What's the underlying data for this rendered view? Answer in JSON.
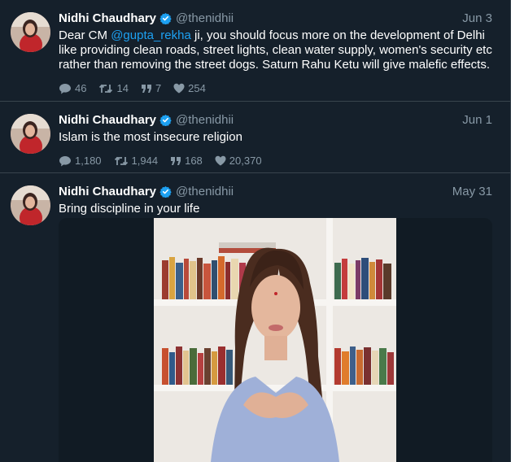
{
  "colors": {
    "background": "#15202b",
    "divider": "#38444d",
    "text_primary": "#ffffff",
    "text_secondary": "#8899a6",
    "link": "#1da1f2",
    "verified": "#1da1f2"
  },
  "tweets": [
    {
      "author": {
        "name": "Nidhi Chaudhary",
        "handle": "@thenidhii",
        "verified_icon": "verified-badge-icon",
        "avatar": "profile-photo"
      },
      "date": "Jun 3",
      "text_prefix": "Dear CM ",
      "mention": "@gupta_rekha",
      "text_suffix": " ji, you should focus more on the development of Delhi like providing clean roads, street lights, clean water supply, women's security etc rather than removing the street dogs. Saturn Rahu Ketu will give malefic effects.",
      "replies": "46",
      "retweets": "14",
      "quotes": "7",
      "likes": "254"
    },
    {
      "author": {
        "name": "Nidhi Chaudhary",
        "handle": "@thenidhii",
        "verified_icon": "verified-badge-icon",
        "avatar": "profile-photo"
      },
      "date": "Jun 1",
      "text": "Islam is the most insecure religion",
      "replies": "1,180",
      "retweets": "1,944",
      "quotes": "168",
      "likes": "20,370"
    },
    {
      "author": {
        "name": "Nidhi Chaudhary",
        "handle": "@thenidhii",
        "verified_icon": "verified-badge-icon",
        "avatar": "profile-photo"
      },
      "date": "May 31",
      "text": "Bring discipline in your life",
      "media": {
        "type": "video",
        "icon": "video-thumbnail-woman-bookshelf"
      }
    }
  ]
}
